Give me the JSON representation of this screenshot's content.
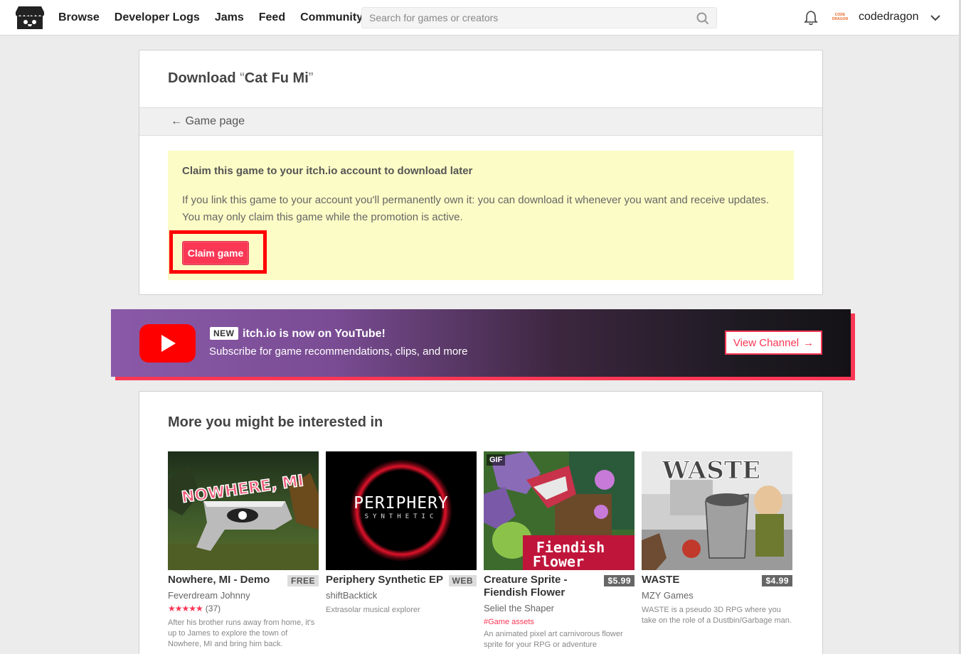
{
  "header": {
    "nav": [
      "Browse",
      "Developer Logs",
      "Jams",
      "Feed",
      "Community"
    ],
    "search_placeholder": "Search for games or creators",
    "avatar_text": [
      "CODE",
      "DRAGON"
    ],
    "username": "codedragon"
  },
  "download": {
    "title_prefix": "Download ",
    "quote_open": "“",
    "game_name": "Cat Fu Mi",
    "quote_close": "”",
    "back_label": "← Game page",
    "notice_title": "Claim this game to your itch.io account to download later",
    "notice_text": "If you link this game to your account you'll permanently own it: you can download it whenever you want and receive updates. You may only claim this game while the promotion is active.",
    "claim_label": "Claim game"
  },
  "youtube": {
    "new_badge": "NEW",
    "title": "itch.io is now on YouTube!",
    "subtitle": "Subscribe for game recommendations, clips, and more",
    "button_label": "View Channel",
    "button_arrow": "→"
  },
  "recommendations": {
    "heading": "More you might be interested in",
    "games": [
      {
        "title": "Nowhere, MI - Demo",
        "price": "FREE",
        "author": "Feverdream Johnny",
        "stars": "★★★★★",
        "rating_count": "(37)",
        "description": "After his brother runs away from home, it's up to James to explore the town of Nowhere, MI and bring him back.",
        "thumb_text": "NOWHERE, MI"
      },
      {
        "title": "Periphery Synthetic EP",
        "price": "WEB",
        "author": "shiftBacktick",
        "description": "Extrasolar musical explorer",
        "thumb_text": "PERIPHERY",
        "thumb_sub": "SYNTHETIC"
      },
      {
        "title": "Creature Sprite - Fiendish Flower",
        "price": "$5.99",
        "author": "Seliel the Shaper",
        "tag": "#Game assets",
        "description": "An animated pixel art carnivorous flower sprite for your RPG or adventure",
        "gif_badge": "GIF",
        "thumb_text": "Fiendish",
        "thumb_text2": "Flower"
      },
      {
        "title": "WASTE",
        "price": "$4.99",
        "author": "MZY Games",
        "description": "WASTE is a pseudo 3D RPG where you take on the role of a Dustbin/Garbage man.",
        "thumb_text": "WASTE"
      }
    ]
  },
  "colors": {
    "accent": "#fa3755",
    "notice_bg": "#fcfcc6",
    "highlight_border": "#ff0000",
    "youtube_red": "#ff0000"
  },
  "icons": [
    "itchio-logo-icon",
    "search-icon",
    "bell-icon",
    "chevron-down-icon",
    "arrow-left-icon",
    "youtube-play-icon",
    "arrow-right-icon"
  ]
}
